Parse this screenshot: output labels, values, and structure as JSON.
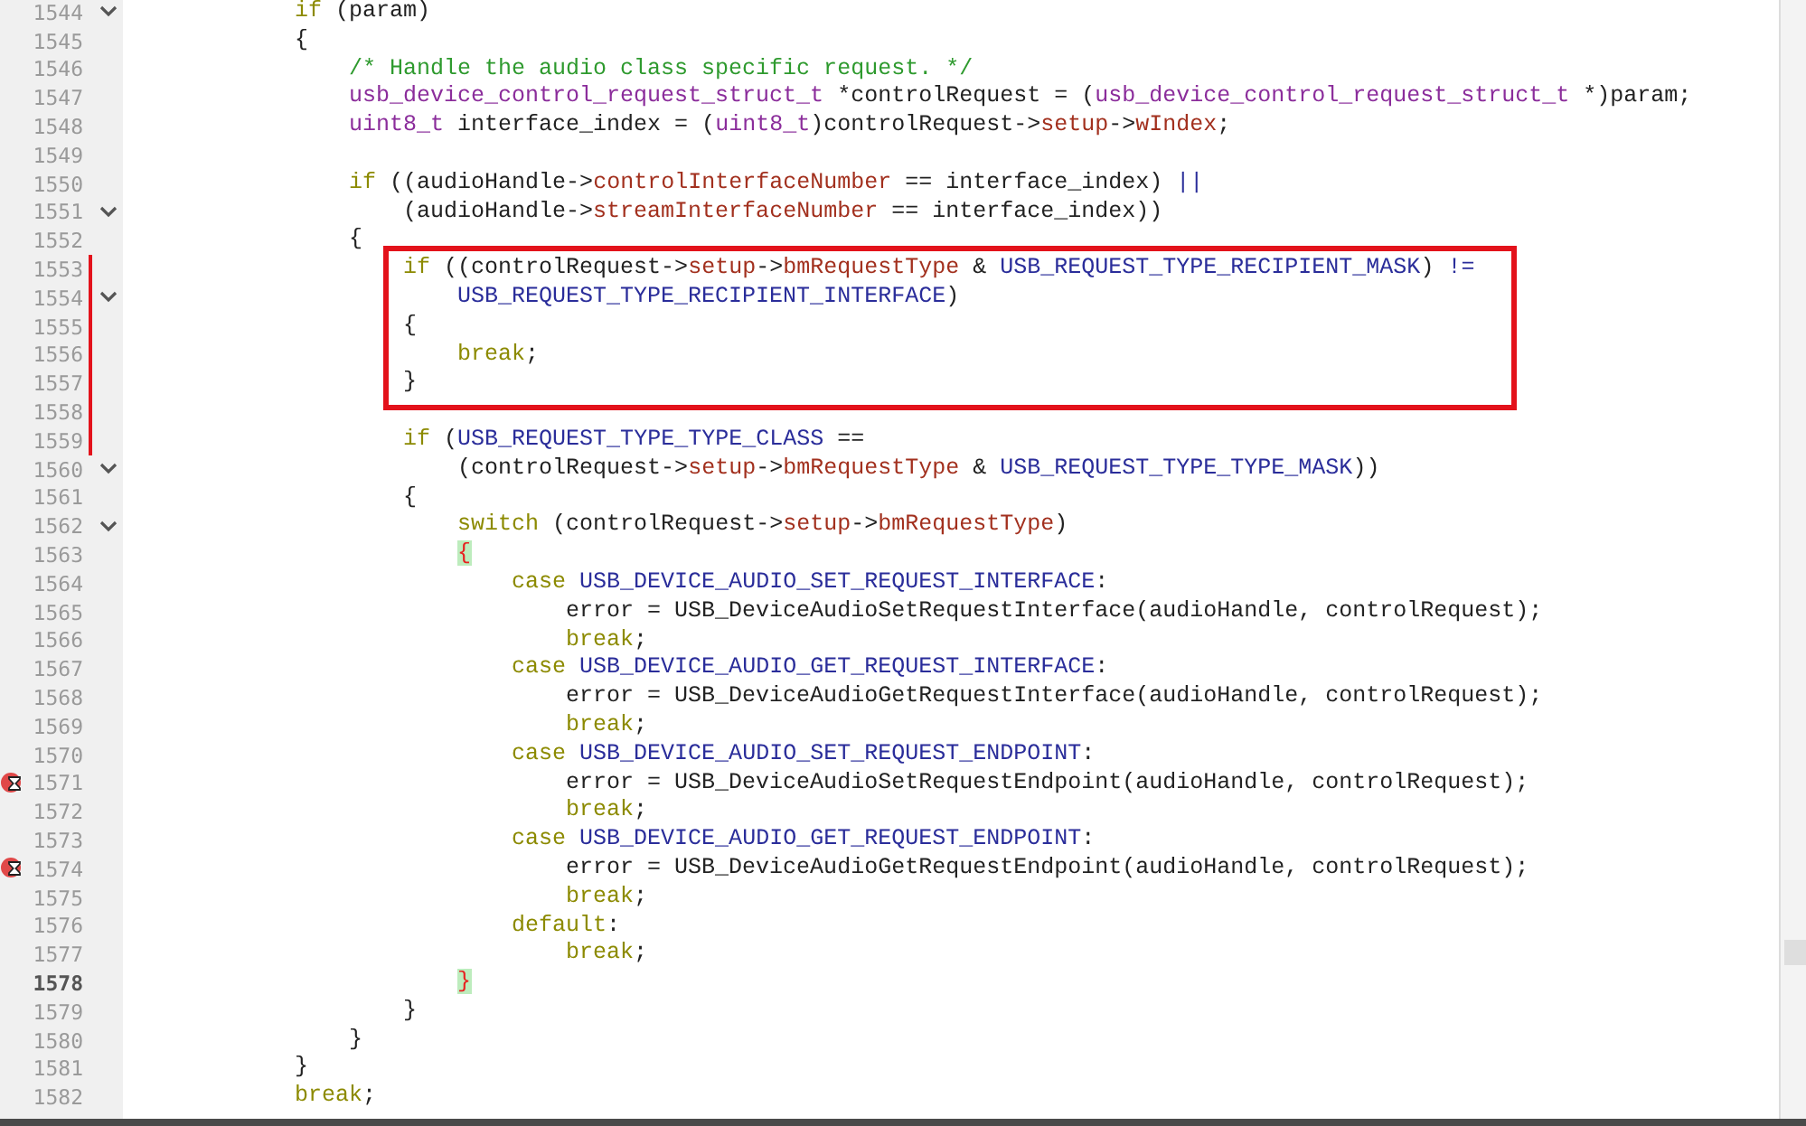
{
  "lines": [
    {
      "number": "1544",
      "fold": true,
      "tokens": [
        {
          "kind": "keyword",
          "text": "            if"
        },
        {
          "kind": "plain",
          "text": " (param)"
        }
      ]
    },
    {
      "number": "1545",
      "tokens": [
        {
          "kind": "plain",
          "text": "            {"
        }
      ]
    },
    {
      "number": "1546",
      "tokens": [
        {
          "kind": "comment",
          "text": "                /* Handle the audio class specific request. */"
        }
      ]
    },
    {
      "number": "1547",
      "tokens": [
        {
          "kind": "type",
          "text": "                usb_device_control_request_struct_t"
        },
        {
          "kind": "plain",
          "text": " *controlRequest = ("
        },
        {
          "kind": "type",
          "text": "usb_device_control_request_struct_t"
        },
        {
          "kind": "plain",
          "text": " *)param;"
        }
      ]
    },
    {
      "number": "1548",
      "tokens": [
        {
          "kind": "type",
          "text": "                uint8_t"
        },
        {
          "kind": "plain",
          "text": " interface_index = ("
        },
        {
          "kind": "type",
          "text": "uint8_t"
        },
        {
          "kind": "plain",
          "text": ")controlRequest->"
        },
        {
          "kind": "member",
          "text": "setup"
        },
        {
          "kind": "plain",
          "text": "->"
        },
        {
          "kind": "member",
          "text": "wIndex"
        },
        {
          "kind": "plain",
          "text": ";"
        }
      ]
    },
    {
      "number": "1549"
    },
    {
      "number": "1550",
      "tokens": [
        {
          "kind": "keyword",
          "text": "                if"
        },
        {
          "kind": "plain",
          "text": " ((audioHandle->"
        },
        {
          "kind": "member",
          "text": "controlInterfaceNumber"
        },
        {
          "kind": "plain",
          "text": " == interface_index) "
        },
        {
          "kind": "macro",
          "text": "||"
        }
      ]
    },
    {
      "number": "1551",
      "fold": true,
      "tokens": [
        {
          "kind": "plain",
          "text": "                    (audioHandle->"
        },
        {
          "kind": "member",
          "text": "streamInterfaceNumber"
        },
        {
          "kind": "plain",
          "text": " == interface_index))"
        }
      ]
    },
    {
      "number": "1552",
      "tokens": [
        {
          "kind": "plain",
          "text": "                {"
        }
      ]
    },
    {
      "number": "1553",
      "changed": true,
      "boxed": true,
      "tokens": [
        {
          "kind": "keyword",
          "text": "                    if"
        },
        {
          "kind": "plain",
          "text": " ((controlRequest->"
        },
        {
          "kind": "member",
          "text": "setup"
        },
        {
          "kind": "plain",
          "text": "->"
        },
        {
          "kind": "member",
          "text": "bmRequestType"
        },
        {
          "kind": "plain",
          "text": " & "
        },
        {
          "kind": "macro",
          "text": "USB_REQUEST_TYPE_RECIPIENT_MASK"
        },
        {
          "kind": "plain",
          "text": ") "
        },
        {
          "kind": "macro",
          "text": "!="
        }
      ]
    },
    {
      "number": "1554",
      "fold": true,
      "changed": true,
      "boxed": true,
      "tokens": [
        {
          "kind": "macro",
          "text": "                        USB_REQUEST_TYPE_RECIPIENT_INTERFACE"
        },
        {
          "kind": "plain",
          "text": ")"
        }
      ]
    },
    {
      "number": "1555",
      "changed": true,
      "boxed": true,
      "tokens": [
        {
          "kind": "plain",
          "text": "                    {"
        }
      ]
    },
    {
      "number": "1556",
      "changed": true,
      "boxed": true,
      "tokens": [
        {
          "kind": "keyword",
          "text": "                        break"
        },
        {
          "kind": "plain",
          "text": ";"
        }
      ]
    },
    {
      "number": "1557",
      "changed": true,
      "boxed": true,
      "tokens": [
        {
          "kind": "plain",
          "text": "                    }"
        }
      ]
    },
    {
      "number": "1558",
      "changed": true
    },
    {
      "number": "1559",
      "changed": true,
      "tokens": [
        {
          "kind": "keyword",
          "text": "                    if"
        },
        {
          "kind": "plain",
          "text": " ("
        },
        {
          "kind": "macro",
          "text": "USB_REQUEST_TYPE_TYPE_CLASS"
        },
        {
          "kind": "plain",
          "text": " =="
        }
      ]
    },
    {
      "number": "1560",
      "fold": true,
      "tokens": [
        {
          "kind": "plain",
          "text": "                        (controlRequest->"
        },
        {
          "kind": "member",
          "text": "setup"
        },
        {
          "kind": "plain",
          "text": "->"
        },
        {
          "kind": "member",
          "text": "bmRequestType"
        },
        {
          "kind": "plain",
          "text": " & "
        },
        {
          "kind": "macro",
          "text": "USB_REQUEST_TYPE_TYPE_MASK"
        },
        {
          "kind": "plain",
          "text": "))"
        }
      ]
    },
    {
      "number": "1561",
      "tokens": [
        {
          "kind": "plain",
          "text": "                    {"
        }
      ]
    },
    {
      "number": "1562",
      "fold": true,
      "tokens": [
        {
          "kind": "keyword",
          "text": "                        switch"
        },
        {
          "kind": "plain",
          "text": " (controlRequest->"
        },
        {
          "kind": "member",
          "text": "setup"
        },
        {
          "kind": "plain",
          "text": "->"
        },
        {
          "kind": "member",
          "text": "bmRequestType"
        },
        {
          "kind": "plain",
          "text": ")"
        }
      ]
    },
    {
      "number": "1563",
      "tokens": [
        {
          "kind": "brace_match",
          "text": "                        {"
        }
      ]
    },
    {
      "number": "1564",
      "tokens": [
        {
          "kind": "keyword",
          "text": "                            case"
        },
        {
          "kind": "macro",
          "text": " USB_DEVICE_AUDIO_SET_REQUEST_INTERFACE"
        },
        {
          "kind": "plain",
          "text": ":"
        }
      ]
    },
    {
      "number": "1565",
      "tokens": [
        {
          "kind": "plain",
          "text": "                                error = USB_DeviceAudioSetRequestInterface(audioHandle, controlRequest);"
        }
      ]
    },
    {
      "number": "1566",
      "tokens": [
        {
          "kind": "keyword",
          "text": "                                break"
        },
        {
          "kind": "plain",
          "text": ";"
        }
      ]
    },
    {
      "number": "1567",
      "tokens": [
        {
          "kind": "keyword",
          "text": "                            case"
        },
        {
          "kind": "macro",
          "text": " USB_DEVICE_AUDIO_GET_REQUEST_INTERFACE"
        },
        {
          "kind": "plain",
          "text": ":"
        }
      ]
    },
    {
      "number": "1568",
      "tokens": [
        {
          "kind": "plain",
          "text": "                                error = USB_DeviceAudioGetRequestInterface(audioHandle, controlRequest);"
        }
      ]
    },
    {
      "number": "1569",
      "tokens": [
        {
          "kind": "keyword",
          "text": "                                break"
        },
        {
          "kind": "plain",
          "text": ";"
        }
      ]
    },
    {
      "number": "1570",
      "tokens": [
        {
          "kind": "keyword",
          "text": "                            case"
        },
        {
          "kind": "macro",
          "text": " USB_DEVICE_AUDIO_SET_REQUEST_ENDPOINT"
        },
        {
          "kind": "plain",
          "text": ":"
        }
      ]
    },
    {
      "number": "1571",
      "breakpoint": true,
      "tokens": [
        {
          "kind": "plain",
          "text": "                                error = USB_DeviceAudioSetRequestEndpoint(audioHandle, controlRequest);"
        }
      ]
    },
    {
      "number": "1572",
      "tokens": [
        {
          "kind": "keyword",
          "text": "                                break"
        },
        {
          "kind": "plain",
          "text": ";"
        }
      ]
    },
    {
      "number": "1573",
      "tokens": [
        {
          "kind": "keyword",
          "text": "                            case"
        },
        {
          "kind": "macro",
          "text": " USB_DEVICE_AUDIO_GET_REQUEST_ENDPOINT"
        },
        {
          "kind": "plain",
          "text": ":"
        }
      ]
    },
    {
      "number": "1574",
      "breakpoint": true,
      "tokens": [
        {
          "kind": "plain",
          "text": "                                error = USB_DeviceAudioGetRequestEndpoint(audioHandle, controlRequest);"
        }
      ]
    },
    {
      "number": "1575",
      "tokens": [
        {
          "kind": "keyword",
          "text": "                                break"
        },
        {
          "kind": "plain",
          "text": ";"
        }
      ]
    },
    {
      "number": "1576",
      "tokens": [
        {
          "kind": "keyword",
          "text": "                            default"
        },
        {
          "kind": "plain",
          "text": ":"
        }
      ]
    },
    {
      "number": "1577",
      "tokens": [
        {
          "kind": "keyword",
          "text": "                                break"
        },
        {
          "kind": "plain",
          "text": ";"
        }
      ]
    },
    {
      "number": "1578",
      "current": true,
      "tokens": [
        {
          "kind": "brace_match",
          "text": "                        }"
        }
      ]
    },
    {
      "number": "1579",
      "tokens": [
        {
          "kind": "plain",
          "text": "                    }"
        }
      ]
    },
    {
      "number": "1580",
      "tokens": [
        {
          "kind": "plain",
          "text": "                }"
        }
      ]
    },
    {
      "number": "1581",
      "tokens": [
        {
          "kind": "plain",
          "text": "            }"
        }
      ]
    },
    {
      "number": "1582",
      "tokens": [
        {
          "kind": "keyword",
          "text": "            break"
        },
        {
          "kind": "plain",
          "text": ";"
        }
      ]
    }
  ]
}
